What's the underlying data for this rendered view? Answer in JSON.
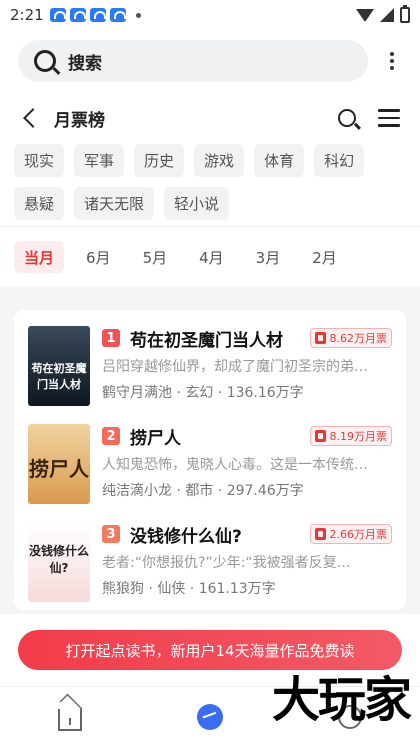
{
  "status_bar": {
    "time": "2:21"
  },
  "search": {
    "placeholder": "搜索"
  },
  "header": {
    "title": "月票榜"
  },
  "genres": [
    "现实",
    "军事",
    "历史",
    "游戏",
    "体育",
    "科幻",
    "悬疑",
    "诸天无限",
    "轻小说"
  ],
  "months": {
    "active": "当月",
    "items": [
      "6月",
      "5月",
      "4月",
      "3月",
      "2月"
    ]
  },
  "books": [
    {
      "rank": "1",
      "title": "苟在初圣魔门当人材",
      "tickets": "8.62万月票",
      "desc": "吕阳穿越修仙界，却成了魔门初圣宗的弟…",
      "meta": "鹤守月满池 · 玄幻 · 136.16万字",
      "cover_text": "苟在初圣魔门当人材"
    },
    {
      "rank": "2",
      "title": "捞尸人",
      "tickets": "8.19万月票",
      "desc": "人知鬼恐怖，鬼晓人心毒。这是一本传统…",
      "meta": "纯洁滴小龙 · 都市 · 297.46万字",
      "cover_text": "捞尸人"
    },
    {
      "rank": "3",
      "title": "没钱修什么仙?",
      "tickets": "2.66万月票",
      "desc": "老者:“你想报仇?”少年:“我被强者反复…",
      "meta": "熊狼狗 · 仙侠 · 161.13万字",
      "cover_text": "没钱修什么仙?"
    }
  ],
  "promo": {
    "text": "打开起点读书，新用户14天海量作品免费读"
  },
  "watermark": "大玩家"
}
